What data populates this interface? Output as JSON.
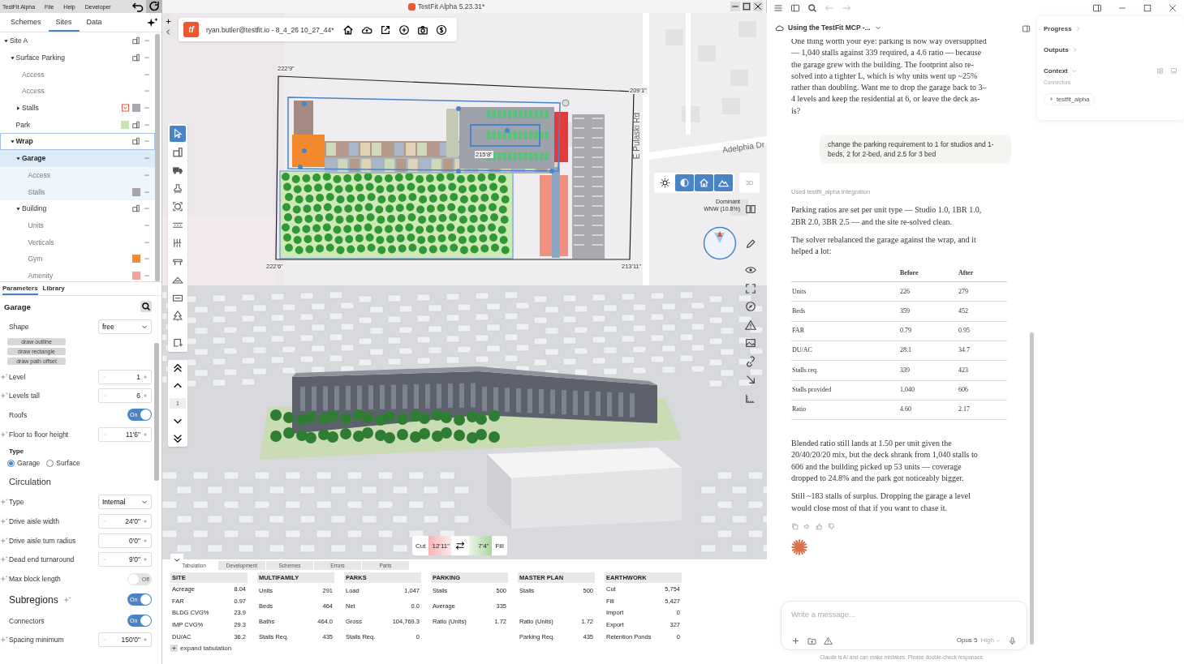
{
  "titlebar": {
    "menu": [
      "TestFit Alpha",
      "File",
      "Help",
      "Developer"
    ],
    "title": "TestFit Alpha 5.23.31*"
  },
  "site_tabs": [
    {
      "label": "Schemes",
      "selected": false
    },
    {
      "label": "Sites",
      "selected": true
    },
    {
      "label": "Data",
      "selected": false
    }
  ],
  "tree": [
    {
      "label": "Site A",
      "expanded": true,
      "selected": false,
      "building": true,
      "children": [
        {
          "label": "Surface Parking",
          "expanded": true,
          "selected": false,
          "building": true,
          "children": [
            {
              "label": "Access",
              "selected": false
            },
            {
              "label": "Access",
              "selected": false
            },
            {
              "label": "Stalls",
              "expanded": false,
              "selected": false,
              "alert": true,
              "color": "#a9aab2"
            }
          ]
        },
        {
          "label": "Park",
          "selected": false,
          "color": "#c6e5b0",
          "building": true
        },
        {
          "label": "Wrap",
          "expanded": true,
          "selected": false,
          "focused": true,
          "building": true,
          "children": [
            {
              "label": "Garage",
              "expanded": true,
              "selected": true,
              "children": [
                {
                  "label": "Access",
                  "selected": false
                },
                {
                  "label": "Stalls",
                  "selected": false,
                  "color": "#a3a3a9"
                }
              ]
            },
            {
              "label": "Building",
              "expanded": true,
              "selected": false,
              "building": true,
              "children": [
                {
                  "label": "Units",
                  "selected": false
                },
                {
                  "label": "Verticals",
                  "selected": false
                },
                {
                  "label": "Gym",
                  "selected": false,
                  "color": "#f28c38"
                },
                {
                  "label": "Amenity",
                  "selected": false,
                  "color": "#f4a29a"
                }
              ]
            }
          ]
        }
      ]
    }
  ],
  "param_tabs": [
    {
      "label": "Parameters",
      "selected": true
    },
    {
      "label": "Library",
      "selected": false
    }
  ],
  "params": {
    "title": "Garage",
    "rows": [
      {
        "kind": "select",
        "label": "Shape",
        "value": "free"
      },
      {
        "kind": "buttons",
        "buttons": [
          "draw outline",
          "draw rectangle",
          "draw path offset"
        ]
      },
      {
        "kind": "stepper",
        "label": "Level",
        "value": "1",
        "ai": true
      },
      {
        "kind": "stepper",
        "label": "Levels tall",
        "value": "6",
        "ai": true
      },
      {
        "kind": "toggle",
        "label": "Roofs",
        "on": true,
        "text": "On"
      },
      {
        "kind": "stepper",
        "label": "Floor to floor height",
        "value": "11'6\"",
        "ai": true
      },
      {
        "kind": "radio",
        "label": "Type",
        "options": [
          {
            "label": "Garage",
            "selected": true
          },
          {
            "label": "Surface",
            "selected": false
          }
        ]
      },
      {
        "kind": "heading",
        "label": "Circulation"
      },
      {
        "kind": "select",
        "label": "Type",
        "value": "Internal",
        "ai": true
      },
      {
        "kind": "stepper",
        "label": "Drive aisle width",
        "value": "24'0\"",
        "ai": true
      },
      {
        "kind": "stepper",
        "label": "Drive aisle turn radius",
        "value": "0'0\"",
        "ai": true,
        "at_min": true
      },
      {
        "kind": "stepper",
        "label": "Dead end turnaround",
        "value": "9'0\"",
        "ai": true
      },
      {
        "kind": "toggle",
        "label": "Max block length",
        "on": false,
        "text": "Off",
        "ai": true
      },
      {
        "kind": "heading_toggle",
        "label": "Subregions",
        "on": true,
        "text": "On"
      },
      {
        "kind": "toggle",
        "label": "Connectors",
        "on": true,
        "text": "On"
      },
      {
        "kind": "stepper",
        "label": "Spacing minimum",
        "value": "150'0\"",
        "ai": true
      }
    ]
  },
  "toolbar": {
    "logo": "tf",
    "file": "ryan.butler@testfit.io - 8_4_26 10_27_44*"
  },
  "tools": [
    {
      "selected": true
    },
    {
      "selected": false
    },
    {
      "selected": false
    },
    {
      "selected": false
    },
    {
      "selected": false
    },
    {
      "selected": false
    },
    {
      "selected": false
    },
    {
      "selected": false
    },
    {
      "selected": false
    },
    {
      "selected": false
    },
    {
      "selected": false
    }
  ],
  "level_nav": {
    "level": "1"
  },
  "map_labels": [
    {
      "kind": "dimension",
      "text": "222'9\""
    },
    {
      "kind": "dimension",
      "text": "209'1\""
    },
    {
      "kind": "street",
      "text": "E Pulaski Rd"
    },
    {
      "kind": "street",
      "text": "Adelphia Dr"
    },
    {
      "kind": "dimension",
      "text": "215'8\""
    },
    {
      "kind": "dimension",
      "text": "222'6\""
    },
    {
      "kind": "dimension",
      "text": "213'11\""
    }
  ],
  "view_modes": [
    {
      "selected": false
    },
    {
      "selected": true
    },
    {
      "selected": true
    },
    {
      "selected": true
    }
  ],
  "view_3d": {
    "label": "3D",
    "selected": false
  },
  "wind": {
    "label": "Dominant",
    "value": "WNW (10.8%)"
  },
  "cut_fill": {
    "cut_label": "Cut",
    "cut": "12'11\"",
    "fill": "7'4\"",
    "fill_label": "Fill"
  },
  "tabulation": {
    "tabs": [
      {
        "label": "Tabulation",
        "selected": true
      },
      {
        "label": "Development",
        "selected": false
      },
      {
        "label": "Schemes",
        "selected": false
      },
      {
        "label": "Errors",
        "selected": false
      },
      {
        "label": "Parts",
        "selected": false
      }
    ],
    "sections": [
      {
        "title": "SITE",
        "rows": [
          {
            "label": "Acreage",
            "value": "8.04"
          },
          {
            "label": "FAR",
            "value": "0.97"
          },
          {
            "label": "BLDG CVG%",
            "value": "23.9"
          },
          {
            "label": "IMP CVG%",
            "value": "29.3"
          },
          {
            "label": "DU/AC",
            "value": "36.2"
          }
        ]
      },
      {
        "title": "MULTIFAMILY",
        "rows": [
          {
            "label": "Units",
            "value": "291"
          },
          {
            "label": "Beds",
            "value": "464"
          },
          {
            "label": "Baths",
            "value": "464.0"
          },
          {
            "label": "Stalls Req.",
            "value": "435"
          }
        ]
      },
      {
        "title": "PARKS",
        "rows": [
          {
            "label": "Load",
            "value": "1,047"
          },
          {
            "label": "Net",
            "value": "0.0"
          },
          {
            "label": "Gross",
            "value": "104,769.3"
          },
          {
            "label": "Stalls Req.",
            "value": "0"
          }
        ]
      },
      {
        "title": "PARKING",
        "rows": [
          {
            "label": "Stalls",
            "value": "500"
          },
          {
            "label": "Average",
            "value": "335"
          },
          {
            "label": "Ratio (Units)",
            "value": "1.72"
          }
        ]
      },
      {
        "title": "MASTER PLAN",
        "rows": [
          {
            "label": "Stalls",
            "value": "500"
          },
          {
            "label": "Ratio (Units)",
            "value": "1.72",
            "gap_before": true
          },
          {
            "label": "Parking Req.",
            "value": "435"
          }
        ]
      },
      {
        "title": "EARTHWORK",
        "rows": [
          {
            "label": "Cut",
            "value": "5,754"
          },
          {
            "label": "Fill",
            "value": "5,427"
          },
          {
            "label": "Import",
            "value": "0"
          },
          {
            "label": "Export",
            "value": "327"
          },
          {
            "label": "Retention Ponds",
            "value": "0"
          }
        ]
      }
    ],
    "expand": "expand tabulation"
  },
  "chat": {
    "title": "Using the TestFit MCP -...",
    "messages": [
      {
        "kind": "assistant",
        "blocks": [
          {
            "kind": "paragraph",
            "text": "One thing worth your eye: parking is now way oversupplied — 1,040 stalls against 339 required, a 4.6 ratio — because the garage grew with the building. The footprint also re-solved into a tighter L, which is why units went up ~25% rather than doubling. Want me to drop the garage back to 3–4 levels and keep the residential at 6, or leave the deck as-is?"
          }
        ]
      },
      {
        "kind": "user",
        "text": "change the parking requirement to 1 for studios and 1-beds, 2 for 2-bed, and 2.5 for 3 bed"
      },
      {
        "kind": "assistant",
        "blocks": [
          {
            "kind": "tool_note",
            "text": "Used testfit_alpha integration"
          },
          {
            "kind": "paragraph",
            "text": "Parking ratios are set per unit type — Studio 1.0, 1BR 1.0, 2BR 2.0, 3BR 2.5 — and the site re-solved clean."
          },
          {
            "kind": "paragraph",
            "text": "The solver rebalanced the garage against the wrap, and it helped a lot:"
          },
          {
            "kind": "table",
            "columns": [
              "Before",
              "After"
            ],
            "rows": [
              {
                "label": "Units",
                "values": [
                  "226",
                  "279"
                ]
              },
              {
                "label": "Beds",
                "values": [
                  "359",
                  "452"
                ]
              },
              {
                "label": "FAR",
                "values": [
                  "0.79",
                  "0.95"
                ]
              },
              {
                "label": "DU/AC",
                "values": [
                  "28.1",
                  "34.7"
                ]
              },
              {
                "label": "Stalls req.",
                "values": [
                  "339",
                  "423"
                ]
              },
              {
                "label": "Stalls provided",
                "values": [
                  "1,040",
                  "606"
                ]
              },
              {
                "label": "Ratio",
                "values": [
                  "4.60",
                  "2.17"
                ]
              }
            ]
          },
          {
            "kind": "paragraph",
            "text": "Blended ratio still lands at 1.50 per unit given the 20/40/20/20 mix, but the deck shrank from 1,040 stalls to 606 and the building picked up 53 units — coverage dropped to 24.8% and the park got noticeably bigger."
          },
          {
            "kind": "paragraph",
            "text": "Still ~183 stalls of surplus. Dropping the garage a level would close most of that if you want to chase it."
          }
        ]
      }
    ],
    "composer": {
      "placeholder": "Write a message...",
      "model": "Opus 5",
      "effort": "High"
    },
    "footer": "Claude is AI and can make mistakes. Please double-check responses."
  },
  "side_panel": [
    {
      "label": "Progress",
      "expanded": false
    },
    {
      "label": "Outputs",
      "expanded": false
    },
    {
      "label": "Context",
      "expanded": true,
      "subheading": "Connectors",
      "chips": [
        "testfit_alpha"
      ]
    }
  ]
}
